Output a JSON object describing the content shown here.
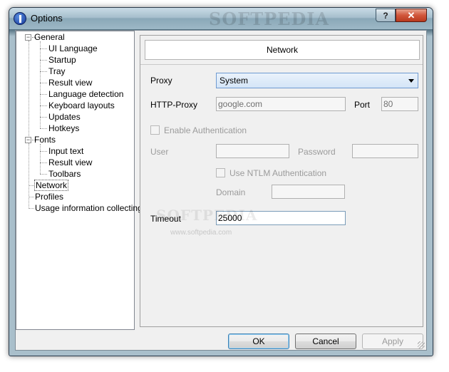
{
  "window": {
    "title": "Options",
    "watermark": "SOFTPEDIA",
    "help_label": "?",
    "close_label": "✕"
  },
  "tree": {
    "general": "General",
    "ui_language": "UI Language",
    "startup": "Startup",
    "tray": "Tray",
    "result_view": "Result view",
    "language_detection": "Language detection",
    "keyboard_layouts": "Keyboard layouts",
    "updates": "Updates",
    "hotkeys": "Hotkeys",
    "fonts": "Fonts",
    "input_text": "Input text",
    "fonts_result_view": "Result view",
    "toolbars": "Toolbars",
    "network": "Network",
    "profiles": "Profiles",
    "usage": "Usage information collecting",
    "collapse_symbol": "−"
  },
  "panel": {
    "header": "Network",
    "proxy_label": "Proxy",
    "proxy_value": "System",
    "http_proxy_label": "HTTP-Proxy",
    "http_proxy_value": "google.com",
    "port_label": "Port",
    "port_value": "80",
    "enable_auth_label": "Enable Authentication",
    "user_label": "User",
    "password_label": "Password",
    "ntlm_label": "Use NTLM Authentication",
    "domain_label": "Domain",
    "timeout_label": "Timeout",
    "timeout_value": "25000",
    "watermark": "SOFTPEDIA",
    "watermark_url": "www.softpedia.com"
  },
  "buttons": {
    "ok": "OK",
    "cancel": "Cancel",
    "apply": "Apply"
  }
}
